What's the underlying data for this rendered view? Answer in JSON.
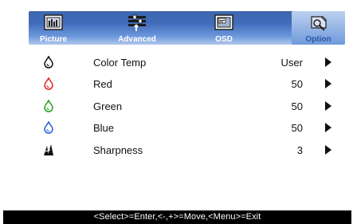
{
  "tabs": [
    {
      "label": "Picture",
      "icon": "picture-icon",
      "active": false
    },
    {
      "label": "Advanced",
      "icon": "advanced-icon",
      "active": false
    },
    {
      "label": "OSD",
      "icon": "osd-icon",
      "active": false
    },
    {
      "label": "Option",
      "icon": "option-icon",
      "active": true
    }
  ],
  "rows": [
    {
      "label": "Color Temp",
      "value": "User",
      "icon": "color-drop-icon",
      "color": "#111111"
    },
    {
      "label": "Red",
      "value": "50",
      "icon": "red-drop-icon",
      "color": "#e02020"
    },
    {
      "label": "Green",
      "value": "50",
      "icon": "green-drop-icon",
      "color": "#20a020"
    },
    {
      "label": "Blue",
      "value": "50",
      "icon": "blue-drop-icon",
      "color": "#2060e0"
    },
    {
      "label": "Sharpness",
      "value": "3",
      "icon": "sharpness-icon",
      "color": "#111111"
    }
  ],
  "help_text": "<Select>=Enter,<-,+>=Move,<Menu>=Exit"
}
